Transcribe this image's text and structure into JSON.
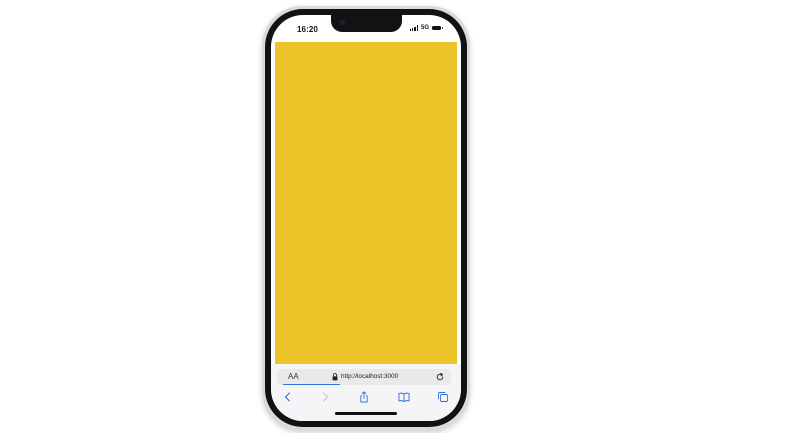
{
  "status_bar": {
    "time": "16:20",
    "network": "5G"
  },
  "page": {
    "background_color": "#ECC42A"
  },
  "safari": {
    "text_size_label": "AA",
    "url": "http://localhost:3000",
    "load_progress": 0.35,
    "accent_color": "#2F6FDE"
  },
  "toolbar": {
    "icons": [
      "back-icon",
      "forward-icon",
      "share-icon",
      "bookmarks-icon",
      "tabs-icon"
    ]
  }
}
